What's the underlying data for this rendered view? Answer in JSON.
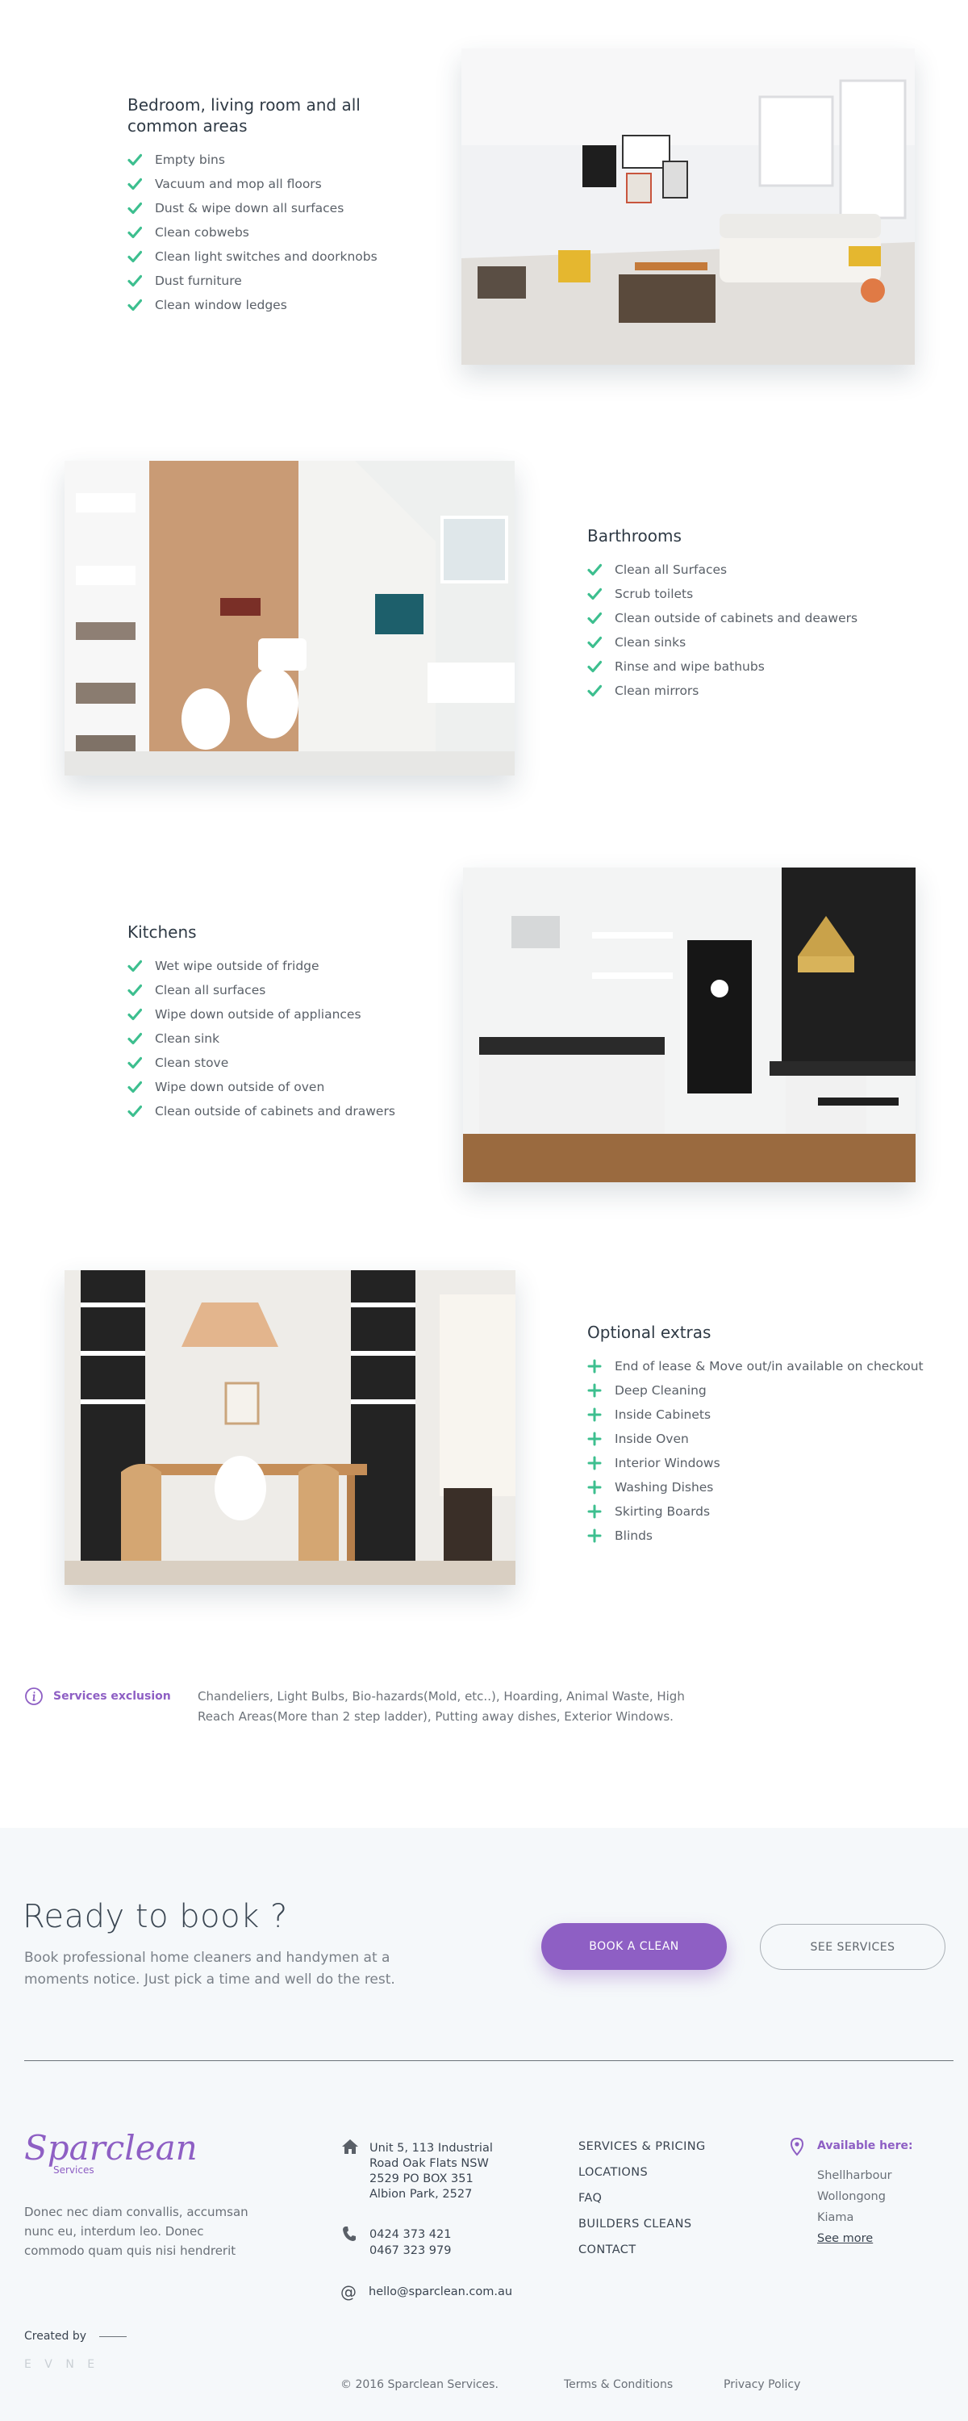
{
  "sections": [
    {
      "title": "Bedroom, living room and all common areas",
      "marker": "check",
      "items": [
        "Empty bins",
        "Vacuum and mop all floors",
        "Dust & wipe down all surfaces",
        "Clean cobwebs",
        "Clean light switches and doorknobs",
        "Dust furniture",
        "Clean window ledges"
      ]
    },
    {
      "title": "Barthrooms",
      "marker": "check",
      "items": [
        "Clean all Surfaces",
        "Scrub toilets",
        "Clean outside of cabinets and deawers",
        "Clean sinks",
        "Rinse and wipe bathubs",
        "Clean mirrors"
      ]
    },
    {
      "title": "Kitchens",
      "marker": "check",
      "items": [
        "Wet wipe outside of fridge",
        "Clean all surfaces",
        "Wipe down outside of appliances",
        "Clean sink",
        "Clean stove",
        "Wipe down outside of oven",
        "Clean outside of cabinets and drawers"
      ]
    },
    {
      "title": "Optional extras",
      "marker": "plus",
      "items": [
        "End of lease & Move out/in available on checkout",
        "Deep Cleaning",
        "Inside Cabinets",
        "Inside Oven",
        "Interior Windows",
        "Washing Dishes",
        "Skirting Boards",
        "Blinds"
      ]
    }
  ],
  "exclusion": {
    "label": "Services exclusion",
    "text": "Chandeliers, Light Bulbs, Bio-hazards(Mold, etc..), Hoarding, Animal Waste, High Reach Areas(More than 2 step ladder), Putting away dishes, Exterior Windows."
  },
  "cta": {
    "heading": "Ready to book ?",
    "subtext": "Book professional home cleaners and handymen at a moments notice.  Just pick a time and well do the rest.",
    "primary_button": "BOOK A CLEAN",
    "secondary_button": "SEE SERVICES"
  },
  "footer": {
    "logo": "Sparclean",
    "logo_sub": "Services",
    "about": "Donec nec diam convallis, accumsan nunc eu, interdum leo. Donec commodo quam quis nisi hendrerit",
    "created_by": "Created by",
    "studio_logo": "E V N E",
    "address": [
      "Unit 5, 113 Industrial",
      "Road Oak Flats NSW",
      "2529 PO BOX 351",
      "Albion Park, 2527"
    ],
    "phones": [
      "0424 373 421",
      "0467 323 979"
    ],
    "email": "hello@sparclean.com.au",
    "nav": [
      "SERVICES & PRICING",
      "LOCATIONS",
      "FAQ",
      "BUILDERS CLEANS",
      "CONTACT"
    ],
    "available_label": "Available here:",
    "locations": [
      "Shellharbour",
      "Wollongong",
      "Kiama"
    ],
    "see_more": "See more",
    "copyright": "© 2016 Sparclean Services.",
    "terms": "Terms & Conditions",
    "privacy": "Privacy Policy"
  },
  "colors": {
    "accent": "#8e5fc4",
    "check_green": "#3dbf8f",
    "footer_bg": "#f5f8fa"
  }
}
